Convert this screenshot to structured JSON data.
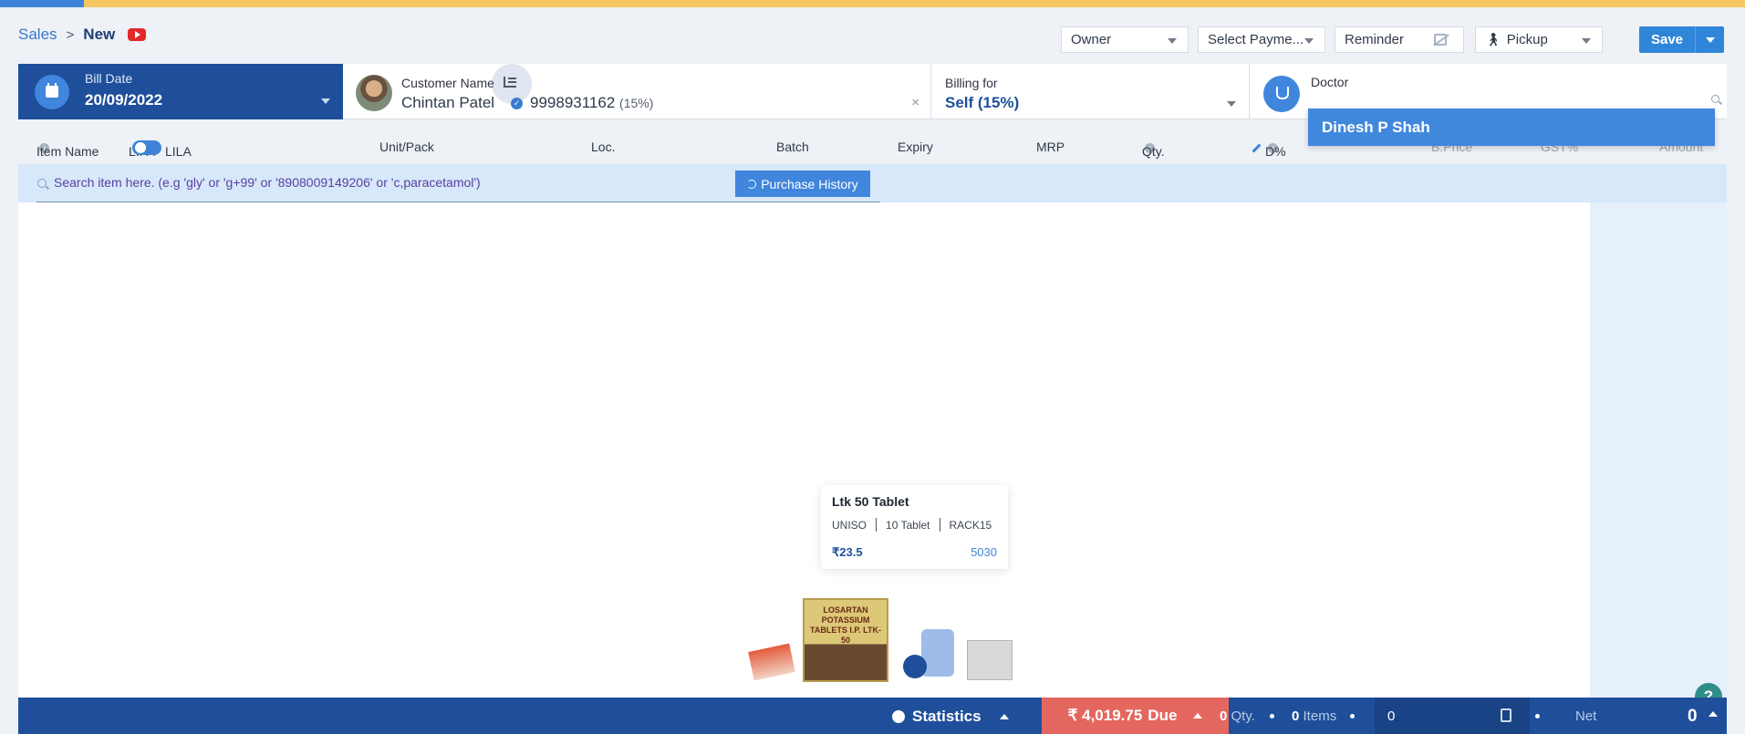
{
  "breadcrumb": {
    "root": "Sales",
    "current": "New"
  },
  "toolbar": {
    "owner": "Owner",
    "payment": "Select Payme...",
    "reminder": "Reminder",
    "delivery": "Pickup",
    "save_label": "Save"
  },
  "bill": {
    "label": "Bill Date",
    "date": "20/09/2022"
  },
  "customer": {
    "label": "Customer Name",
    "name": "Chintan Patel",
    "phone": "9998931162",
    "discount": "(15%)",
    "clear": "×"
  },
  "billing": {
    "label": "Billing for",
    "value": "Self (15%)"
  },
  "doctor": {
    "label": "Doctor",
    "dropdown_option": "Dinesh P Shah"
  },
  "columns": {
    "item_name": "Item Name",
    "lifa": "LIFA",
    "lila": "LILA",
    "unit_pack": "Unit/Pack",
    "loc": "Loc.",
    "batch": "Batch",
    "expiry": "Expiry",
    "mrp": "MRP",
    "qty": "Qty.",
    "dpct": "D%",
    "bprice": "B.Price",
    "gst": "GST%",
    "amount": "Amount"
  },
  "search": {
    "placeholder": "Search item here. (e.g 'gly' or 'g+99' or '8908009149206' or 'c,paracetamol')",
    "history_button": "Purchase History"
  },
  "product_card": {
    "name": "Ltk 50 Tablet",
    "manufacturer": "UNISO",
    "pack": "10 Tablet",
    "rack": "RACK15",
    "price": "₹23.5",
    "code": "5030",
    "box_text": "LOSARTAN POTASSIUM TABLETS I.P. LTK-50"
  },
  "footer": {
    "statistics": "Statistics",
    "due_amount": "₹ 4,019.75",
    "due_label": "Due",
    "qty_value": "0",
    "qty_label": "Qty.",
    "items_value": "0",
    "items_label": "Items",
    "subtotal": "0",
    "net_label": "Net",
    "net_value": "0"
  },
  "help": "?",
  "colors": {
    "primary": "#1f4f9b",
    "accent": "#3f86dc",
    "due": "#e4675f",
    "top_stripe": "#f5c863"
  }
}
